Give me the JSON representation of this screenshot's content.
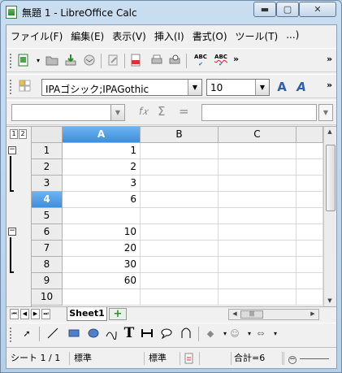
{
  "window": {
    "title": "無題 1 - LibreOffice Calc",
    "minimize_glyph": "▬",
    "maximize_glyph": "▢",
    "close_glyph": "✕"
  },
  "menu": [
    {
      "label": "ファイル(F)"
    },
    {
      "label": "編集(E)"
    },
    {
      "label": "表示(V)"
    },
    {
      "label": "挿入(I)"
    },
    {
      "label": "書式(O)"
    },
    {
      "label": "ツール(T)"
    },
    {
      "label": "...)"
    }
  ],
  "standard_toolbar": {
    "icons": [
      "new-document-icon",
      "open-folder-icon",
      "save-icon",
      "email-icon",
      "edit-file-icon",
      "export-pdf-icon",
      "print-icon",
      "print-preview-icon",
      "spellcheck-icon",
      "autospellcheck-icon"
    ],
    "abc1": "ABC",
    "abc2": "ABC",
    "overflow": "»",
    "end_overflow": "»"
  },
  "format_toolbar": {
    "font_name": "IPAゴシック;IPAGothic",
    "font_size": "10",
    "overflow": "»"
  },
  "formula_bar": {
    "name_box": "",
    "fx": "f𝑥",
    "sum": "Σ",
    "equals": "=",
    "formula": ""
  },
  "grid": {
    "level_buttons": [
      "1",
      "2"
    ],
    "columns": [
      {
        "label": "A",
        "selected": true
      },
      {
        "label": "B",
        "selected": false
      },
      {
        "label": "C",
        "selected": false
      }
    ],
    "rows": [
      {
        "label": "1",
        "a": "1",
        "selected": false
      },
      {
        "label": "2",
        "a": "2",
        "selected": false
      },
      {
        "label": "3",
        "a": "3",
        "selected": false
      },
      {
        "label": "4",
        "a": "6",
        "selected": true
      },
      {
        "label": "5",
        "a": "",
        "selected": false
      },
      {
        "label": "6",
        "a": "10",
        "selected": false
      },
      {
        "label": "7",
        "a": "20",
        "selected": false
      },
      {
        "label": "8",
        "a": "30",
        "selected": false
      },
      {
        "label": "9",
        "a": "60",
        "selected": false
      },
      {
        "label": "10",
        "a": "",
        "selected": false
      }
    ],
    "collapse_glyph": "−"
  },
  "sheets": {
    "tabs": [
      "Sheet1"
    ],
    "add_glyph": "+",
    "nav": [
      "⏮",
      "◀",
      "▶",
      "⏭"
    ]
  },
  "status": {
    "sheet": "シート 1 / 1",
    "style": "標準",
    "mode": "標準",
    "sum": "合計=6"
  },
  "colors": {
    "selection": "#3a8fde",
    "accent_green": "#2d8f2d"
  }
}
